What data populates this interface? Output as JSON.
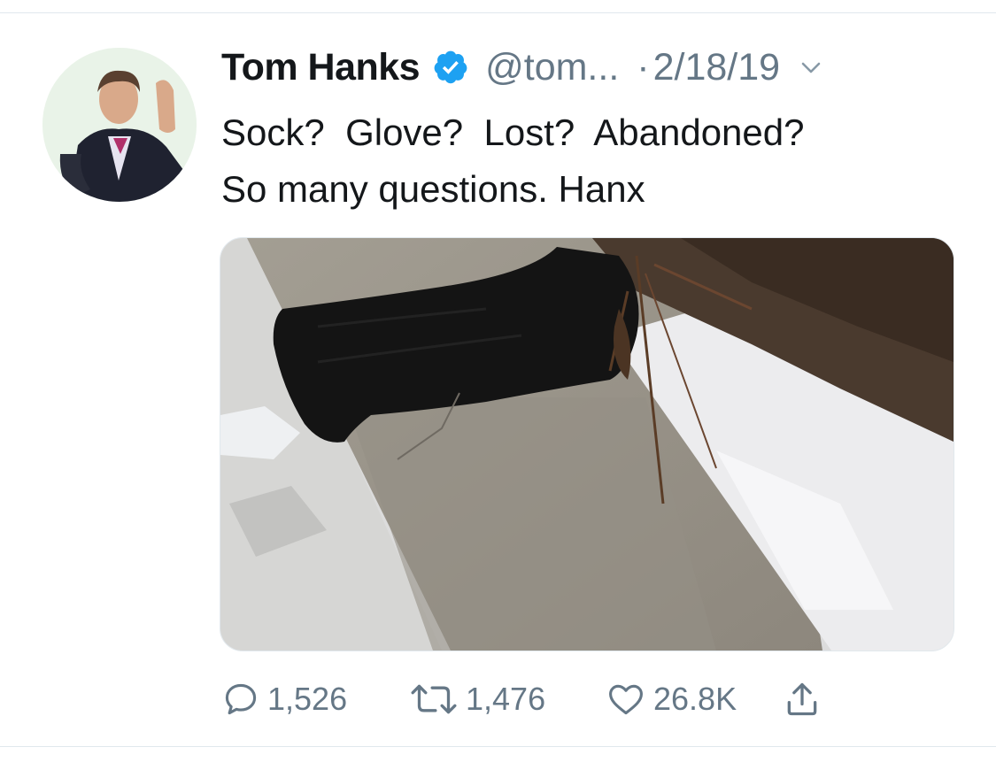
{
  "tweet": {
    "author_name": "Tom Hanks",
    "handle": "@tom...",
    "separator": "·",
    "date": "2/18/19",
    "text_lines": [
      "Sock?  Glove?  Lost?  Abandoned?",
      "So many questions. Hanx"
    ]
  },
  "actions": {
    "replies": "1,526",
    "retweets": "1,476",
    "likes": "26.8K"
  },
  "icons": {
    "verified": "verified-badge-icon",
    "menu": "chevron-down-icon",
    "reply": "reply-icon",
    "retweet": "retweet-icon",
    "like": "heart-icon",
    "share": "share-icon"
  },
  "colors": {
    "text": "#14171a",
    "secondary": "#657786",
    "verified": "#1da1f2",
    "divider": "#e1e8ed"
  }
}
